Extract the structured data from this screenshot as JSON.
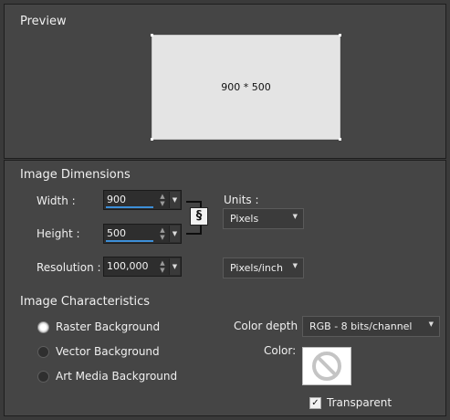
{
  "preview": {
    "title": "Preview",
    "size_text": "900 * 500"
  },
  "dimensions": {
    "title": "Image Dimensions",
    "width_label": "Width :",
    "width_value": "900",
    "height_label": "Height :",
    "height_value": "500",
    "resolution_label": "Resolution :",
    "resolution_value": "100,000",
    "units_label": "Units :",
    "units_value": "Pixels",
    "res_units_value": "Pixels/inch",
    "link_icon": "chain-link-icon"
  },
  "characteristics": {
    "title": "Image Characteristics",
    "options": [
      {
        "label": "Raster Background",
        "selected": true
      },
      {
        "label": "Vector Background",
        "selected": false
      },
      {
        "label": "Art Media Background",
        "selected": false
      }
    ],
    "color_depth_label": "Color depth :",
    "color_depth_value": "RGB - 8 bits/channel",
    "color_label": "Color:",
    "color_icon": "no-color-icon",
    "transparent_label": "Transparent",
    "transparent_checked": true
  },
  "colors": {
    "panel_bg": "#454545",
    "accent": "#3d8fd8"
  }
}
